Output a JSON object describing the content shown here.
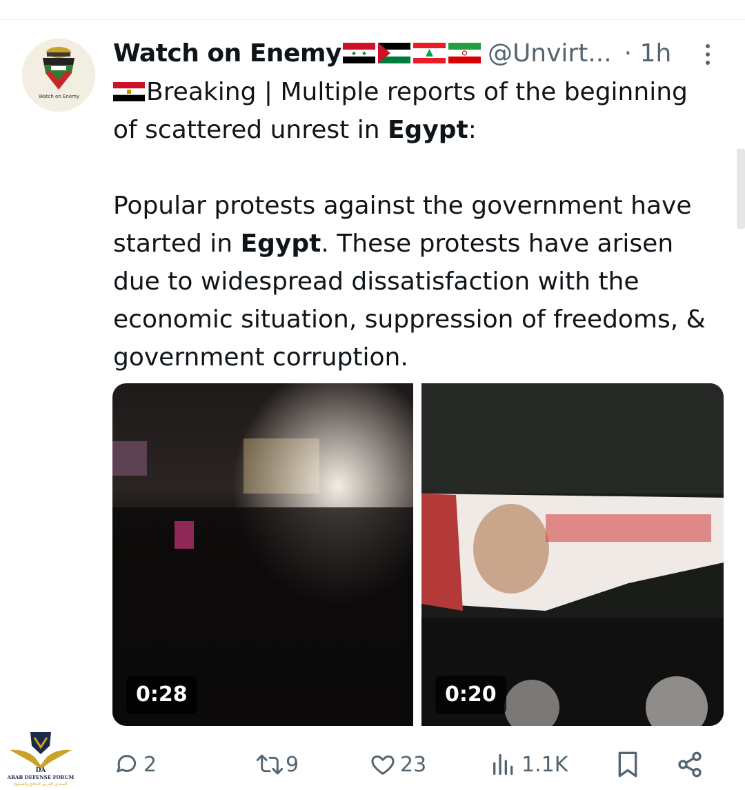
{
  "author": {
    "name": "Watch on Enemy",
    "handle": "@Unvirt...",
    "time": "· 1h",
    "flags": [
      "syria-flag",
      "palestine-flag",
      "lebanon-flag",
      "iran-flag"
    ],
    "avatar_text": "Watch on Enemy"
  },
  "post": {
    "line1": "Breaking | Multiple reports of the beginning",
    "line2_pre": "of scattered unrest in ",
    "line2_bold": "Egypt",
    "line2_post": ":",
    "p2_pre": "Popular protests against the government have started in ",
    "p2_bold": "Egypt",
    "p2_post": ". These protests have arisen due to widespread dissatisfaction with the economic situation, suppression of freedoms, & government corruption."
  },
  "media": [
    {
      "duration": "0:28"
    },
    {
      "duration": "0:20"
    }
  ],
  "actions": {
    "replies": "2",
    "reposts": "9",
    "likes": "23",
    "views": "1.1K"
  },
  "watermark": {
    "title": "ARAB DEFENSE FORUM",
    "arabic": "المنتدى العربي للدفاع والتسليح",
    "initials": "DA"
  },
  "colors": {
    "text": "#0f1419",
    "secondary": "#536471",
    "divider": "#eff3f4"
  }
}
